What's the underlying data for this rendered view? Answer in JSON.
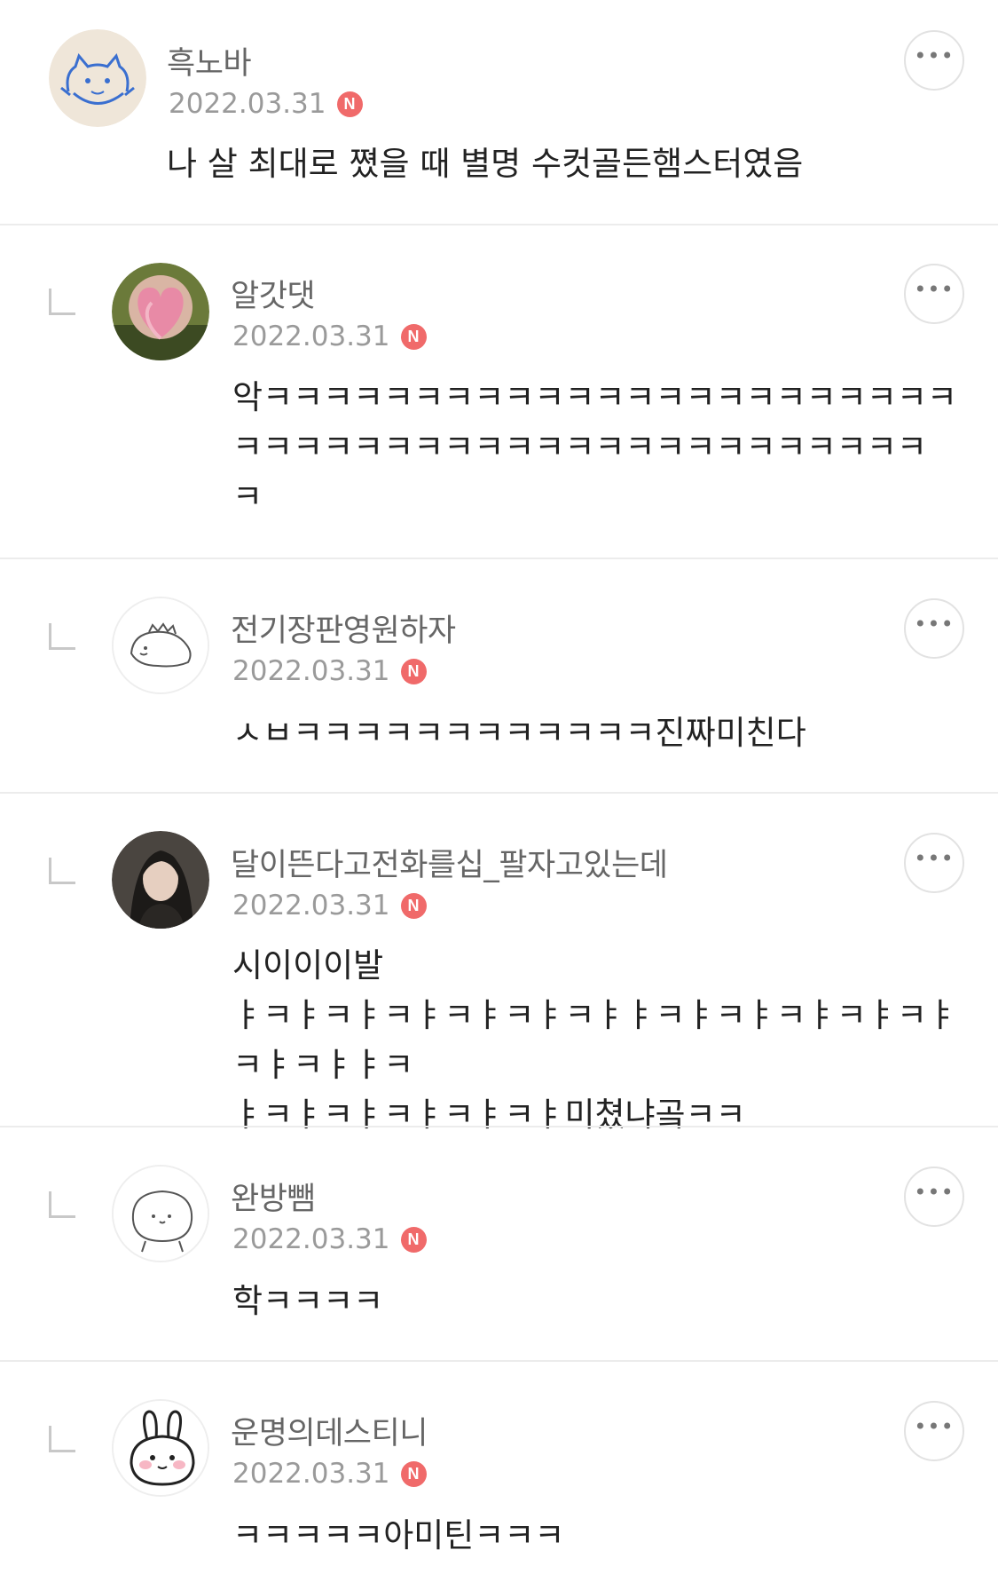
{
  "comments": [
    {
      "nickname": "흑노바",
      "date": "2022.03.31",
      "badge": "N",
      "text": "나 살 최대로 쪘을 때 별명 수컷골든햄스터였음",
      "is_reply": false,
      "avatar_icon": "cat-drawing-avatar"
    },
    {
      "nickname": "알갓댓",
      "date": "2022.03.31",
      "badge": "N",
      "text": "악ㅋㅋㅋㅋㅋㅋㅋㅋㅋㅋㅋㅋㅋㅋㅋㅋㅋㅋㅋㅋㅋㅋㅋ\nㅋㅋㅋㅋㅋㅋㅋㅋㅋㅋㅋㅋㅋㅋㅋㅋㅋㅋㅋㅋㅋㅋㅋ\nㅋ",
      "is_reply": true,
      "avatar_icon": "heart-photo-avatar"
    },
    {
      "nickname": "전기장판영원하자",
      "date": "2022.03.31",
      "badge": "N",
      "text": "ㅅㅂㅋㅋㅋㅋㅋㅋㅋㅋㅋㅋㅋㅋ진짜미친다",
      "is_reply": true,
      "avatar_icon": "dinosaur-drawing-avatar"
    },
    {
      "nickname": "달이뜬다고전화를십_팔자고있는데",
      "date": "2022.03.31",
      "badge": "N",
      "text": "시이이이발\nㅑㅋㅑㅋㅑㅋㅑㅋㅑㅋㅑㅋㅑㅑㅋㅑㅋㅑㅋㅑㅋㅑㅋㅑㅋㅑㅋㅑㅑㅋ\nㅑㅋㅑㅋㅑㅋㅑㅋㅑㅋㅑ미쳤냐곸ㅋㅋ",
      "is_reply": true,
      "avatar_icon": "person-photo-avatar"
    },
    {
      "nickname": "완방뺌",
      "date": "2022.03.31",
      "badge": "N",
      "text": "학ㅋㅋㅋㅋ",
      "is_reply": true,
      "avatar_icon": "blob-drawing-avatar"
    },
    {
      "nickname": "운명의데스티니",
      "date": "2022.03.31",
      "badge": "N",
      "text": "ㅋㅋㅋㅋㅋ아미틴ㅋㅋㅋ",
      "is_reply": true,
      "avatar_icon": "bunny-drawing-avatar"
    }
  ],
  "more_button_glyph": "•••",
  "colors": {
    "badge": "#f06a6a",
    "nickname": "#666666",
    "date": "#9a9a9a",
    "divider": "#ececec"
  }
}
